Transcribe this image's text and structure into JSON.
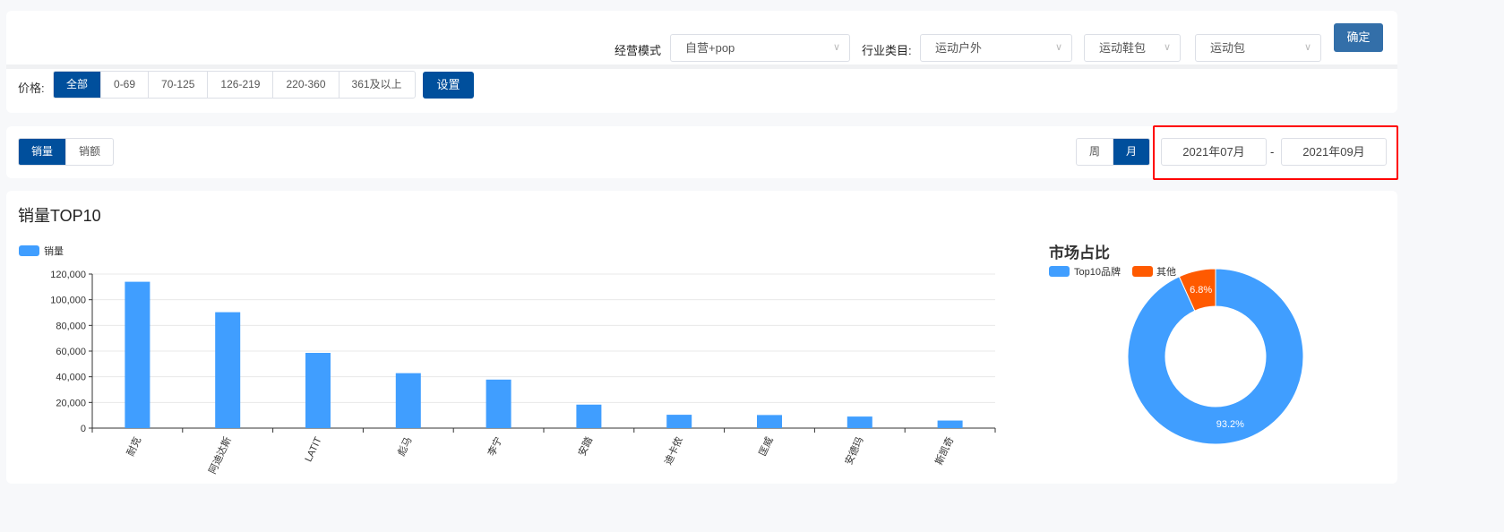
{
  "filters": {
    "mode_label": "经营模式",
    "mode_value": "自营+pop",
    "category_label": "行业类目:",
    "category_1": "运动户外",
    "category_2": "运动鞋包",
    "category_3": "运动包",
    "confirm_label": "确定",
    "price_label": "价格:",
    "price_options": [
      "全部",
      "0-69",
      "70-125",
      "126-219",
      "220-360",
      "361及以上"
    ],
    "price_selected": "全部",
    "settings_label": "设置"
  },
  "metrics": {
    "tabs": [
      "销量",
      "销额"
    ],
    "selected": "销量"
  },
  "period": {
    "tabs": [
      "周",
      "月"
    ],
    "selected": "月",
    "start": "2021年07月",
    "separator": "-",
    "end": "2021年09月"
  },
  "highlight_color": "#ff0000",
  "accent_color": "#004f9c",
  "bar_title": "销量TOP10",
  "chart_data": [
    {
      "type": "bar",
      "legend": [
        "销量"
      ],
      "color": "#409eff",
      "categories": [
        "耐克",
        "阿迪达斯",
        "LATIT",
        "彪马",
        "李宁",
        "安踏",
        "迪卡侬",
        "匡威",
        "安德玛",
        "斯凯奇"
      ],
      "values": [
        114000,
        90300,
        58600,
        42800,
        37800,
        18300,
        10400,
        10200,
        9000,
        5900
      ],
      "ylim": [
        0,
        120000
      ],
      "yticks": [
        "0",
        "20,000",
        "40,000",
        "60,000",
        "80,000",
        "100,000",
        "120,000"
      ],
      "grid": true
    },
    {
      "type": "pie",
      "title": "市场占比",
      "legend": [
        "Top10品牌",
        "其他"
      ],
      "values": [
        93.2,
        6.8
      ],
      "labels": [
        "93.2%",
        "6.8%"
      ],
      "colors": [
        "#409eff",
        "#ff5a00"
      ],
      "donut": true
    }
  ]
}
